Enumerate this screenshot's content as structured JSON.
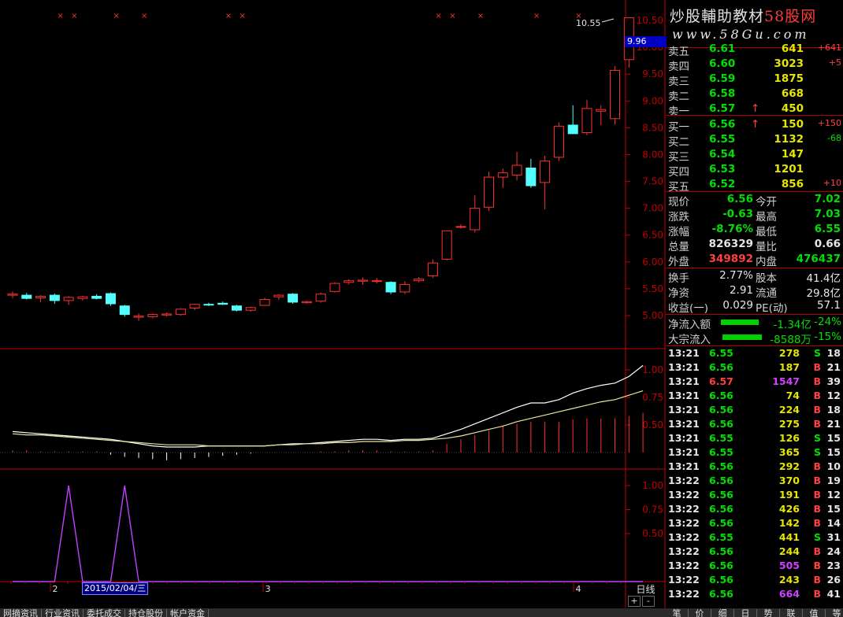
{
  "watermark": {
    "line1_a": "炒股輔助教材",
    "line1_b": "58股网",
    "line2": "www.58Gu.com"
  },
  "price_axis": {
    "ticks": [
      "10.50",
      "10.00",
      "9.50",
      "9.00",
      "8.50",
      "8.00",
      "7.50",
      "7.00",
      "6.50",
      "6.00",
      "5.50",
      "5.00"
    ],
    "values": [
      10.5,
      10,
      9.5,
      9,
      8.5,
      8,
      7.5,
      7,
      6.5,
      6,
      5.5,
      5
    ]
  },
  "vol_axis": {
    "ticks": [
      "1.00",
      "0.75",
      "0.50"
    ]
  },
  "ind_axis": {
    "ticks": [
      "1.00",
      "0.75",
      "0.50"
    ]
  },
  "current_price_tag": "9.96",
  "high_label": "10.55",
  "cursor_date": "2015/02/04/三",
  "x_labels": [
    "2",
    "3",
    "4"
  ],
  "period": "日线",
  "pm_buttons": [
    "+",
    "-"
  ],
  "bottom_tabs": [
    "网摘资讯",
    "行业资讯",
    "委托成交",
    "持仓股份",
    "帐户资金"
  ],
  "right_tabs": [
    "笔",
    "价",
    "细",
    "日",
    "势",
    "联",
    "值",
    "等"
  ],
  "colors": {
    "up": "#ff3030",
    "down": "#54ffff",
    "bg": "#000000",
    "grid": "#8b0000"
  },
  "candles": [
    {
      "o": 5.38,
      "h": 5.45,
      "l": 5.32,
      "c": 5.4
    },
    {
      "o": 5.38,
      "h": 5.42,
      "l": 5.3,
      "c": 5.32
    },
    {
      "o": 5.33,
      "h": 5.38,
      "l": 5.25,
      "c": 5.36
    },
    {
      "o": 5.38,
      "h": 5.41,
      "l": 5.22,
      "c": 5.28
    },
    {
      "o": 5.28,
      "h": 5.36,
      "l": 5.2,
      "c": 5.34
    },
    {
      "o": 5.32,
      "h": 5.37,
      "l": 5.28,
      "c": 5.35
    },
    {
      "o": 5.36,
      "h": 5.4,
      "l": 5.3,
      "c": 5.32
    },
    {
      "o": 5.41,
      "h": 5.43,
      "l": 5.18,
      "c": 5.22
    },
    {
      "o": 5.18,
      "h": 5.2,
      "l": 4.98,
      "c": 5.02
    },
    {
      "o": 4.97,
      "h": 5.04,
      "l": 4.9,
      "c": 4.99
    },
    {
      "o": 4.98,
      "h": 5.04,
      "l": 4.95,
      "c": 5.02
    },
    {
      "o": 5.01,
      "h": 5.06,
      "l": 4.98,
      "c": 5.03
    },
    {
      "o": 5.02,
      "h": 5.14,
      "l": 5.0,
      "c": 5.12
    },
    {
      "o": 5.14,
      "h": 5.22,
      "l": 5.1,
      "c": 5.21
    },
    {
      "o": 5.21,
      "h": 5.24,
      "l": 5.18,
      "c": 5.2
    },
    {
      "o": 5.23,
      "h": 5.26,
      "l": 5.2,
      "c": 5.21
    },
    {
      "o": 5.18,
      "h": 5.2,
      "l": 5.08,
      "c": 5.1
    },
    {
      "o": 5.1,
      "h": 5.17,
      "l": 5.07,
      "c": 5.15
    },
    {
      "o": 5.19,
      "h": 5.33,
      "l": 5.18,
      "c": 5.3
    },
    {
      "o": 5.35,
      "h": 5.4,
      "l": 5.29,
      "c": 5.38
    },
    {
      "o": 5.4,
      "h": 5.42,
      "l": 5.22,
      "c": 5.25
    },
    {
      "o": 5.24,
      "h": 5.28,
      "l": 5.22,
      "c": 5.26
    },
    {
      "o": 5.27,
      "h": 5.43,
      "l": 5.24,
      "c": 5.4
    },
    {
      "o": 5.45,
      "h": 5.62,
      "l": 5.43,
      "c": 5.6
    },
    {
      "o": 5.62,
      "h": 5.68,
      "l": 5.58,
      "c": 5.65
    },
    {
      "o": 5.64,
      "h": 5.71,
      "l": 5.58,
      "c": 5.66
    },
    {
      "o": 5.64,
      "h": 5.7,
      "l": 5.6,
      "c": 5.65
    },
    {
      "o": 5.62,
      "h": 5.64,
      "l": 5.4,
      "c": 5.44
    },
    {
      "o": 5.44,
      "h": 5.64,
      "l": 5.4,
      "c": 5.58
    },
    {
      "o": 5.65,
      "h": 5.72,
      "l": 5.62,
      "c": 5.68
    },
    {
      "o": 5.74,
      "h": 6.05,
      "l": 5.7,
      "c": 5.98
    },
    {
      "o": 6.05,
      "h": 6.58,
      "l": 6.03,
      "c": 6.58
    },
    {
      "o": 6.66,
      "h": 6.7,
      "l": 6.62,
      "c": 6.66
    },
    {
      "o": 6.6,
      "h": 7.24,
      "l": 6.55,
      "c": 7.0
    },
    {
      "o": 7.02,
      "h": 7.68,
      "l": 6.95,
      "c": 7.58
    },
    {
      "o": 7.58,
      "h": 7.74,
      "l": 7.38,
      "c": 7.66
    },
    {
      "o": 7.62,
      "h": 8.05,
      "l": 7.52,
      "c": 7.8
    },
    {
      "o": 7.75,
      "h": 7.92,
      "l": 7.38,
      "c": 7.42
    },
    {
      "o": 7.48,
      "h": 7.98,
      "l": 6.98,
      "c": 7.88
    },
    {
      "o": 7.95,
      "h": 8.6,
      "l": 7.88,
      "c": 8.53
    },
    {
      "o": 8.55,
      "h": 8.92,
      "l": 8.39,
      "c": 8.39
    },
    {
      "o": 8.41,
      "h": 9.02,
      "l": 8.36,
      "c": 8.86
    },
    {
      "o": 8.81,
      "h": 8.92,
      "l": 8.55,
      "c": 8.84
    },
    {
      "o": 8.67,
      "h": 9.65,
      "l": 8.56,
      "c": 9.57
    },
    {
      "o": 9.77,
      "h": 10.55,
      "l": 9.62,
      "c": 10.55
    }
  ],
  "mac_line1": [
    0.44,
    0.43,
    0.42,
    0.41,
    0.4,
    0.39,
    0.38,
    0.37,
    0.35,
    0.33,
    0.31,
    0.3,
    0.3,
    0.3,
    0.31,
    0.31,
    0.31,
    0.31,
    0.31,
    0.32,
    0.33,
    0.33,
    0.34,
    0.35,
    0.36,
    0.37,
    0.37,
    0.36,
    0.37,
    0.37,
    0.38,
    0.42,
    0.46,
    0.51,
    0.56,
    0.61,
    0.66,
    0.7,
    0.7,
    0.73,
    0.79,
    0.83,
    0.86,
    0.88,
    0.94,
    1.04
  ],
  "mac_line2": [
    0.42,
    0.41,
    0.41,
    0.4,
    0.39,
    0.38,
    0.37,
    0.36,
    0.35,
    0.34,
    0.33,
    0.32,
    0.32,
    0.32,
    0.31,
    0.31,
    0.31,
    0.31,
    0.31,
    0.32,
    0.32,
    0.33,
    0.33,
    0.34,
    0.34,
    0.35,
    0.35,
    0.35,
    0.36,
    0.36,
    0.37,
    0.38,
    0.4,
    0.43,
    0.46,
    0.49,
    0.53,
    0.56,
    0.59,
    0.62,
    0.65,
    0.68,
    0.71,
    0.73,
    0.77,
    0.81
  ],
  "mac_bars": [
    0.02,
    0.02,
    0.01,
    0.01,
    0.01,
    0.01,
    0.01,
    -0.02,
    -0.04,
    -0.05,
    -0.06,
    -0.07,
    -0.06,
    -0.05,
    -0.04,
    -0.03,
    -0.02,
    -0.01,
    0.0,
    0.0,
    0.0,
    0.0,
    0.01,
    0.01,
    0.02,
    0.02,
    0.02,
    0.01,
    0.01,
    0.01,
    0.02,
    0.08,
    0.12,
    0.16,
    0.2,
    0.24,
    0.26,
    0.28,
    0.28,
    0.28,
    0.3,
    0.31,
    0.31,
    0.31,
    0.33,
    0.36
  ],
  "peak_signal": [
    0,
    0,
    0,
    0,
    1,
    0,
    0,
    0,
    1,
    0,
    0,
    0,
    0,
    0,
    0,
    0,
    0,
    0,
    0,
    0,
    0,
    0,
    0,
    0,
    0,
    0,
    0,
    0,
    0,
    0,
    0,
    0,
    0,
    0,
    0,
    0,
    0,
    0,
    0,
    0,
    0,
    0,
    0,
    0,
    0,
    0
  ],
  "top_markers": [
    2,
    3,
    6,
    8,
    14,
    15,
    29,
    30,
    32,
    36,
    39
  ],
  "order_book": [
    {
      "label": "卖五",
      "price": "6.61",
      "vol": "641",
      "chg": "+641"
    },
    {
      "label": "卖四",
      "price": "6.60",
      "vol": "3023",
      "chg": "+5"
    },
    {
      "label": "卖三",
      "price": "6.59",
      "vol": "1875",
      "chg": ""
    },
    {
      "label": "卖二",
      "price": "6.58",
      "vol": "668",
      "chg": ""
    },
    {
      "label": "卖一",
      "price": "6.57",
      "vol": "450",
      "chg": "",
      "arrow": "↑"
    },
    {
      "label": "买一",
      "price": "6.56",
      "vol": "150",
      "chg": "+150",
      "arrow": "↑"
    },
    {
      "label": "买二",
      "price": "6.55",
      "vol": "1132",
      "chg": "-68"
    },
    {
      "label": "买三",
      "price": "6.54",
      "vol": "147",
      "chg": ""
    },
    {
      "label": "买四",
      "price": "6.53",
      "vol": "1201",
      "chg": ""
    },
    {
      "label": "买五",
      "price": "6.52",
      "vol": "856",
      "chg": "+10"
    }
  ],
  "quote": [
    {
      "l1": "现价",
      "v1": "6.56",
      "c1": "green",
      "l2": "今开",
      "v2": "7.02",
      "c2": "green"
    },
    {
      "l1": "涨跌",
      "v1": "-0.63",
      "c1": "green",
      "l2": "最高",
      "v2": "7.03",
      "c2": "green"
    },
    {
      "l1": "涨幅",
      "v1": "-8.76%",
      "c1": "green",
      "l2": "最低",
      "v2": "6.55",
      "c2": "green"
    },
    {
      "l1": "总量",
      "v1": "826329",
      "c1": "white",
      "l2": "量比",
      "v2": "0.66",
      "c2": "white"
    },
    {
      "l1": "外盘",
      "v1": "349892",
      "c1": "red",
      "l2": "内盘",
      "v2": "476437",
      "c2": "green"
    }
  ],
  "stats": [
    {
      "l1": "换手",
      "v1": "2.77%",
      "l2": "股本",
      "v2": "41.4亿"
    },
    {
      "l1": "净资",
      "v1": "2.91",
      "l2": "流通",
      "v2": "29.8亿"
    },
    {
      "l1": "收益(一)",
      "v1": "0.029",
      "l2": "PE(动)",
      "v2": "57.1"
    }
  ],
  "flows": [
    {
      "label": "净流入额",
      "value": "-1.34亿",
      "pct": "-24%"
    },
    {
      "label": "大宗流入",
      "value": "-8588万",
      "pct": "-15%"
    }
  ],
  "ticks": [
    {
      "t": "13:21",
      "p": "6.55",
      "v": "278",
      "s": "S",
      "n": "18"
    },
    {
      "t": "13:21",
      "p": "6.56",
      "v": "187",
      "s": "B",
      "n": "21"
    },
    {
      "t": "13:21",
      "p": "6.57",
      "v": "1547",
      "s": "B",
      "n": "39"
    },
    {
      "t": "13:21",
      "p": "6.56",
      "v": "74",
      "s": "B",
      "n": "12"
    },
    {
      "t": "13:21",
      "p": "6.56",
      "v": "224",
      "s": "B",
      "n": "18"
    },
    {
      "t": "13:21",
      "p": "6.56",
      "v": "275",
      "s": "B",
      "n": "21"
    },
    {
      "t": "13:21",
      "p": "6.55",
      "v": "126",
      "s": "S",
      "n": "15"
    },
    {
      "t": "13:21",
      "p": "6.55",
      "v": "365",
      "s": "S",
      "n": "15"
    },
    {
      "t": "13:21",
      "p": "6.56",
      "v": "292",
      "s": "B",
      "n": "10"
    },
    {
      "t": "13:22",
      "p": "6.56",
      "v": "370",
      "s": "B",
      "n": "19"
    },
    {
      "t": "13:22",
      "p": "6.56",
      "v": "191",
      "s": "B",
      "n": "12"
    },
    {
      "t": "13:22",
      "p": "6.56",
      "v": "426",
      "s": "B",
      "n": "15"
    },
    {
      "t": "13:22",
      "p": "6.56",
      "v": "142",
      "s": "B",
      "n": "14"
    },
    {
      "t": "13:22",
      "p": "6.55",
      "v": "441",
      "s": "S",
      "n": "31"
    },
    {
      "t": "13:22",
      "p": "6.56",
      "v": "244",
      "s": "B",
      "n": "24"
    },
    {
      "t": "13:22",
      "p": "6.56",
      "v": "505",
      "s": "B",
      "n": "23"
    },
    {
      "t": "13:22",
      "p": "6.56",
      "v": "243",
      "s": "B",
      "n": "26"
    },
    {
      "t": "13:22",
      "p": "6.56",
      "v": "664",
      "s": "B",
      "n": "41"
    }
  ]
}
